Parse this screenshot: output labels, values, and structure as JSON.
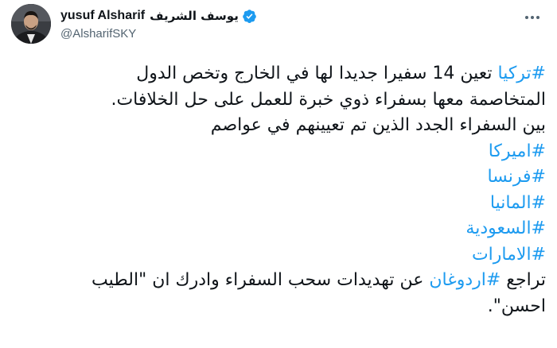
{
  "author": {
    "name_latin": "yusuf Alsharif",
    "name_arabic": "يوسف الشريف",
    "handle": "@AlsharifSKY",
    "verified_icon": "verified-badge-icon",
    "verified_color": "#1d9bf0"
  },
  "menu_icon": "more-options-icon",
  "tweet": {
    "line1": {
      "hashtag": "#تركيا",
      "text": " تعين 14 سفيرا جديدا لها في الخارج وتخص الدول"
    },
    "line2": "المتخاصمة معها بسفراء ذوي خبرة للعمل على حل الخلافات.",
    "line3": "بين السفراء الجدد الذين تم تعيينهم في عواصم",
    "hashtags": [
      "#اميركا",
      "#فرنسا",
      "#المانيا",
      "#السعودية",
      "#الامارات"
    ],
    "last_line": {
      "before": "تراجع ",
      "hashtag": "#اردوغان",
      "after": " عن تهديدات سحب السفراء وادرك ان \"الطيب"
    },
    "final_line": "احسن\"."
  },
  "colors": {
    "text": "#0f1419",
    "secondary": "#536471",
    "link": "#1d9bf0"
  }
}
